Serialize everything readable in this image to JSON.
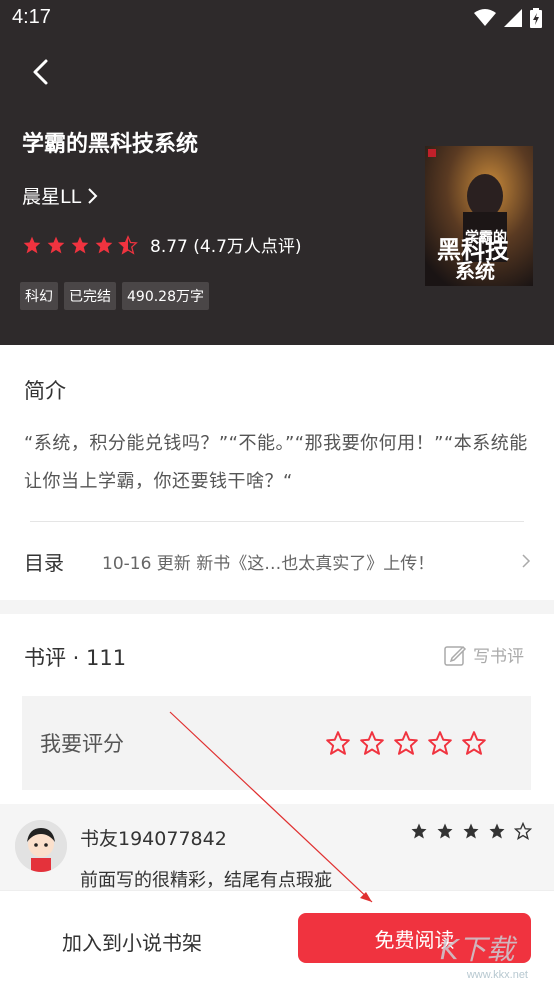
{
  "status": {
    "time": "4:17"
  },
  "book": {
    "title": "学霸的黑科技系统",
    "author": "晨星LL",
    "rating_value": 4.5,
    "rating_text": "8.77 (4.7万人点评)",
    "tags": [
      "科幻",
      "已完结",
      "490.28万字"
    ],
    "cover_text": "学霸的黑科技系统"
  },
  "intro": {
    "title": "简介",
    "text": "“系统，积分能兑钱吗？”“不能。”“那我要你何用！”“本系统能让你当上学霸，你还要钱干啥？“"
  },
  "catalog": {
    "label": "目录",
    "update": "10-16  更新  新书《这…也太真实了》上传！"
  },
  "review": {
    "title": "书评 · 111",
    "write_label": "写书评",
    "rate_label": "我要评分",
    "rate_stars": 5,
    "comment": {
      "user": "书友194077842",
      "stars": 4,
      "text": "前面写的很精彩，结尾有点瑕疵"
    }
  },
  "bottom": {
    "shelf_label": "加入到小说书架",
    "read_label": "免费阅读"
  },
  "watermark": {
    "text": "www.kkx.net"
  },
  "colors": {
    "accent": "#f0333f",
    "header_bg": "#2e2a2b"
  },
  "icons": [
    "back-arrow-icon",
    "chevron-right-icon",
    "star-icon",
    "edit-icon",
    "wifi-icon",
    "signal-icon",
    "battery-icon"
  ]
}
